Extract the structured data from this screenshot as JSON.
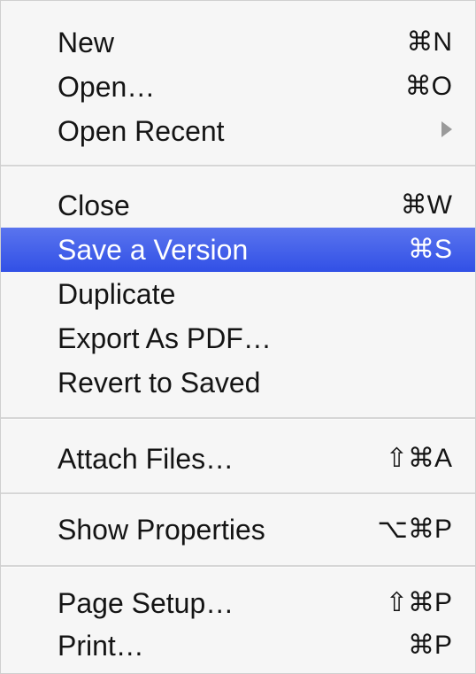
{
  "menu": {
    "items": [
      {
        "label": "New",
        "shortcut": "⌘N"
      },
      {
        "label": "Open…",
        "shortcut": "⌘O"
      },
      {
        "label": "Open Recent",
        "submenu_icon": "triangle-right-icon"
      },
      {
        "label": "Close",
        "shortcut": "⌘W"
      },
      {
        "label": "Save a Version",
        "shortcut": "⌘S",
        "highlighted": true
      },
      {
        "label": "Duplicate"
      },
      {
        "label": "Export As PDF…"
      },
      {
        "label": "Revert to Saved"
      },
      {
        "label": "Attach Files…",
        "shortcut": "⇧⌘A"
      },
      {
        "label": "Show Properties",
        "shortcut": "⌥⌘P"
      },
      {
        "label": "Page Setup…",
        "shortcut": "⇧⌘P"
      },
      {
        "label": "Print…",
        "shortcut": "⌘P"
      }
    ],
    "highlight_color": "#3a58e9"
  }
}
